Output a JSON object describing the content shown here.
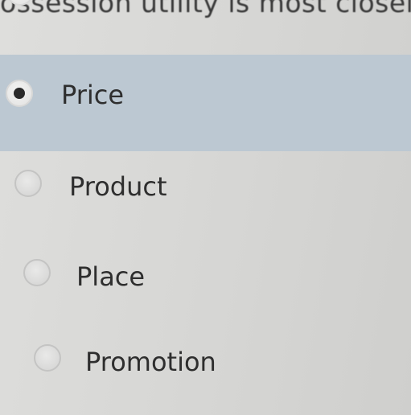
{
  "question": {
    "fragment": "ossession utility is most closely r"
  },
  "options": [
    {
      "label": "Price",
      "selected": true
    },
    {
      "label": "Product",
      "selected": false
    },
    {
      "label": "Place",
      "selected": false
    },
    {
      "label": "Promotion",
      "selected": false
    }
  ],
  "colors": {
    "selected_row": "#bcc8d2",
    "background": "#d8d8d6",
    "text": "#2e2e2e"
  }
}
